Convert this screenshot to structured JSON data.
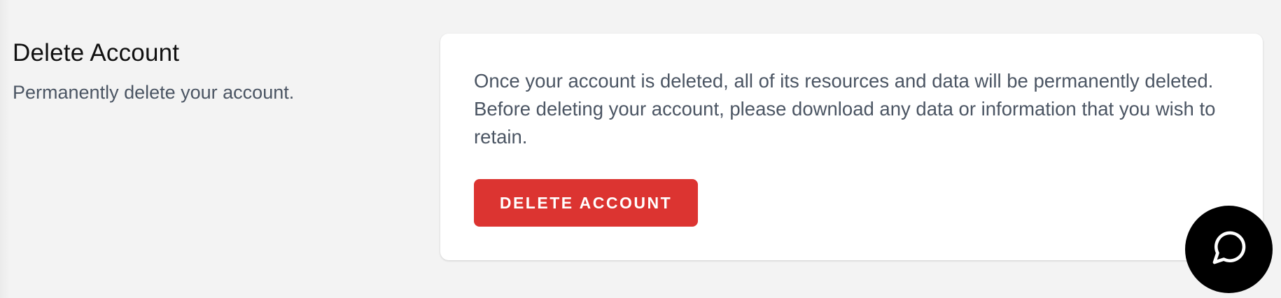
{
  "section": {
    "title": "Delete Account",
    "description": "Permanently delete your account."
  },
  "card": {
    "message": "Once your account is deleted, all of its resources and data will be permanently deleted. Before deleting your account, please download any data or information that you wish to retain.",
    "delete_button_label": "DELETE ACCOUNT"
  },
  "icons": {
    "chat": "chat-bubble-icon"
  },
  "colors": {
    "danger": "#dc3431",
    "background": "#f3f3f3",
    "card": "#ffffff",
    "chat_button": "#000000"
  }
}
